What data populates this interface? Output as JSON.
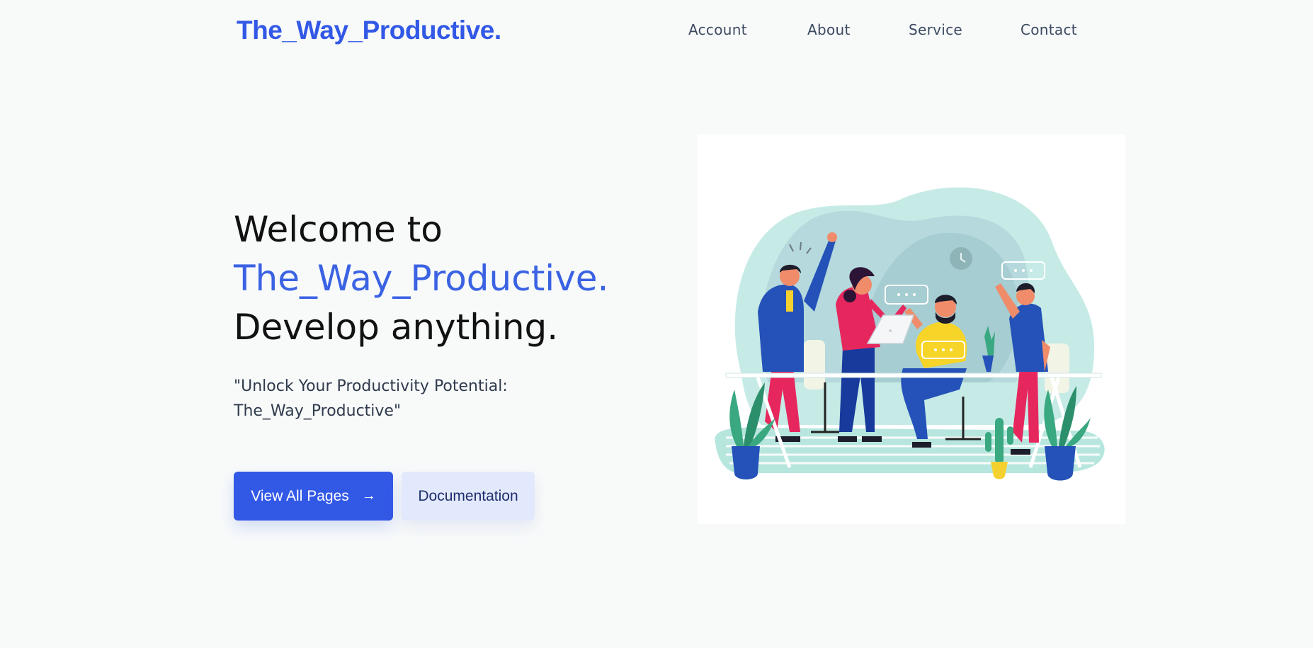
{
  "header": {
    "logo": "The_Way_Productive.",
    "nav": [
      {
        "label": "Account"
      },
      {
        "label": "About"
      },
      {
        "label": "Service"
      },
      {
        "label": "Contact"
      }
    ]
  },
  "hero": {
    "title_line1": "Welcome to",
    "title_line2": "The_Way_Productive.",
    "title_line3": "Develop anything.",
    "tagline": "\"Unlock Your Productivity Potential: The_Way_Productive\"",
    "primary_button": "View All Pages",
    "primary_button_icon": "arrow-right-icon",
    "secondary_button": "Documentation"
  },
  "colors": {
    "brand": "#3258e6",
    "background": "#f8fafa",
    "secondary_button_bg": "#e3e9fc"
  }
}
